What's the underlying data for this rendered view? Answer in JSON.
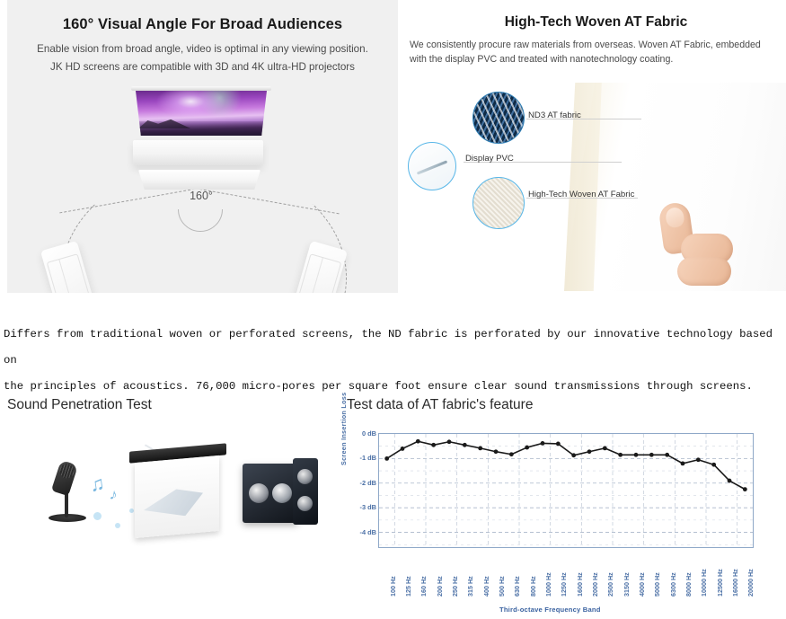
{
  "left_panel": {
    "title": "160° Visual Angle For Broad Audiences",
    "subtitle_line1": "Enable vision from broad angle, video is optimal in any viewing position.",
    "subtitle_line2": "JK HD screens are compatible with 3D and 4K ultra-HD projectors",
    "angle_label": "160°"
  },
  "right_panel": {
    "title": "High-Tech Woven AT Fabric",
    "subtitle": "We consistently procure raw materials from overseas. Woven AT Fabric, embedded with the display PVC and treated with nanotechnology coating.",
    "callouts": [
      {
        "label": "ND3 AT fabric"
      },
      {
        "label": "Display PVC"
      },
      {
        "label": "High-Tech Woven AT Fabric"
      }
    ]
  },
  "paragraph": {
    "line1": "Differs from traditional woven or perforated screens, the ND fabric is perforated by our innovative technology based on",
    "line2": "the principles of acoustics. 76,000 micro-pores per square foot ensure clear sound transmissions through screens."
  },
  "sound_test": {
    "title": "Sound Penetration Test"
  },
  "chart_section": {
    "title": "Test data of AT fabric's feature"
  },
  "colors": {
    "panel_bg": "#f0f0f0",
    "axis_text": "#4a6fa5",
    "plot_border": "#8fa8c8",
    "grid": "#aab6c9",
    "series_line": "#1a1a1a",
    "callout_ring": "#57b6e8"
  },
  "chart_data": {
    "type": "line",
    "title": "Test data of AT fabric's feature",
    "xlabel": "Third-octave Frequency Band",
    "ylabel": "Screen Insertion Loss",
    "ylim": [
      -4.6,
      0
    ],
    "yticks": [
      0,
      -1,
      -2,
      -3,
      -4
    ],
    "ytick_labels": [
      "0 dB",
      "-1 dB",
      "-2 dB",
      "-3 dB",
      "-4 dB"
    ],
    "grid": true,
    "legend": "none",
    "categories": [
      "100 Hz",
      "125 Hz",
      "160 Hz",
      "200 Hz",
      "250 Hz",
      "315 Hz",
      "400 Hz",
      "500 Hz",
      "630 Hz",
      "800 Hz",
      "1000 Hz",
      "1250 Hz",
      "1600 Hz",
      "2000 Hz",
      "2500 Hz",
      "3150 Hz",
      "4000 Hz",
      "5000 Hz",
      "6300 Hz",
      "8000 Hz",
      "10000 Hz",
      "12500 Hz",
      "16000 Hz",
      "20000 Hz"
    ],
    "series": [
      {
        "name": "Screen Insertion Loss",
        "values": [
          -1.0,
          -0.6,
          -0.3,
          -0.45,
          -0.32,
          -0.45,
          -0.58,
          -0.72,
          -0.83,
          -0.55,
          -0.38,
          -0.4,
          -0.87,
          -0.72,
          -0.58,
          -0.85,
          -0.85,
          -0.85,
          -0.85,
          -1.2,
          -1.05,
          -1.25,
          -1.9,
          -2.25
        ]
      }
    ]
  }
}
